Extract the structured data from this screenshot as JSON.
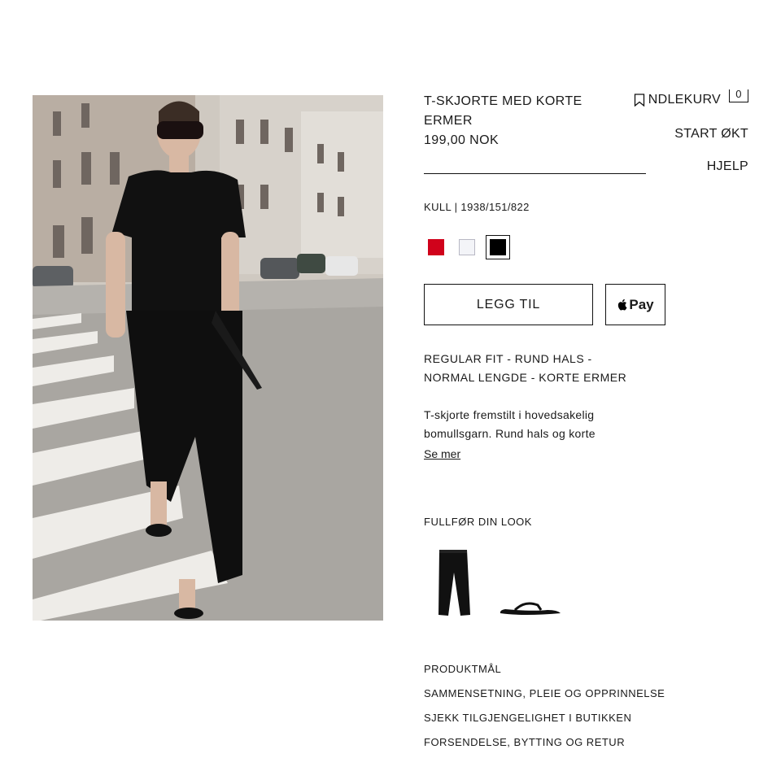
{
  "nav": {
    "basket_label": "NDLEKURV",
    "basket_count": "0",
    "start_label": "START ØKT",
    "help_label": "HJELP"
  },
  "product": {
    "title": "T-SKJORTE MED KORTE ERMER",
    "price": "199,00 NOK",
    "color_ref": "KULL | 1938/151/822",
    "swatches": [
      {
        "name": "red",
        "color": "#d0021b"
      },
      {
        "name": "white",
        "color": "#f3f4f8"
      },
      {
        "name": "black",
        "color": "#000000",
        "selected": true
      }
    ],
    "add_label": "LEGG TIL",
    "pay_label": "Pay",
    "fit_text": "REGULAR FIT - RUND HALS - NORMAL LENGDE - KORTE ERMER",
    "description": "T-skjorte fremstilt i hovedsakelig bomullsgarn. Rund hals og korte",
    "more_label": "Se mer"
  },
  "look": {
    "title": "FULLFØR DIN LOOK",
    "items": [
      "trousers-thumbnail",
      "sandal-thumbnail"
    ]
  },
  "links": [
    "PRODUKTMÅL",
    "SAMMENSETNING, PLEIE OG OPPRINNELSE",
    "SJEKK TILGJENGELIGHET I BUTIKKEN",
    "FORSENDELSE, BYTTING OG RETUR"
  ],
  "colors": {
    "text": "#1a1a1a",
    "accent_red": "#d0021b"
  }
}
